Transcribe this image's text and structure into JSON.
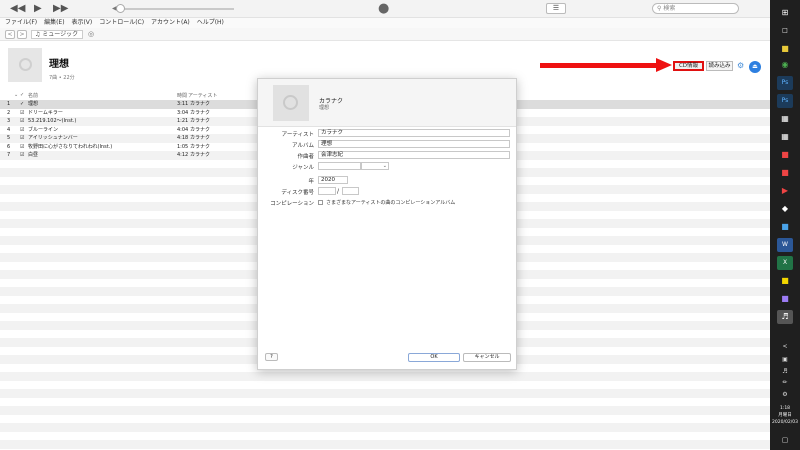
{
  "player": {
    "rewind": "◀◀",
    "play": "▶",
    "forward": "▶▶",
    "volume_icon": "◀"
  },
  "search": {
    "placeholder": "検索",
    "icon": "search-icon"
  },
  "menu": [
    "ファイル(F)",
    "編集(E)",
    "表示(V)",
    "コントロール(C)",
    "アカウント(A)",
    "ヘルプ(H)"
  ],
  "nav": {
    "back": "<",
    "forward": ">",
    "library": "♫ ミュージック"
  },
  "album": {
    "title": "理想",
    "meta": "7曲 • 22分",
    "cd_info_button": "CD情報",
    "import_button": "読み込み"
  },
  "table": {
    "headers": {
      "name": "名前",
      "time": "時間",
      "artist": "アーティスト"
    },
    "rows": [
      {
        "num": "1",
        "check": "✓",
        "name": "理想",
        "time": "3:11",
        "artist": "カラナク"
      },
      {
        "num": "2",
        "check": "☑",
        "name": "ドリームキラー",
        "time": "3:04",
        "artist": "カラナク"
      },
      {
        "num": "3",
        "check": "☑",
        "name": "53.219.102〜(Inst.)",
        "time": "1:21",
        "artist": "カラナク"
      },
      {
        "num": "4",
        "check": "☑",
        "name": "ブルーライン",
        "time": "4:04",
        "artist": "カラナク"
      },
      {
        "num": "5",
        "check": "☑",
        "name": "アイリッシュナンバー",
        "time": "4:18",
        "artist": "カラナク"
      },
      {
        "num": "6",
        "check": "☑",
        "name": "牧野田に心がさなりてわれわれ(Inst.)",
        "time": "1:05",
        "artist": "カラナク"
      },
      {
        "num": "7",
        "check": "☑",
        "name": "白昼",
        "time": "4:12",
        "artist": "カラナク"
      }
    ]
  },
  "dialog": {
    "header_artist": "カラナク",
    "header_album": "理想",
    "labels": {
      "artist": "アーティスト",
      "album": "アルバム",
      "composer": "作曲者",
      "genre": "ジャンル",
      "year": "年",
      "disc": "ディスク番号",
      "compilation": "コンピレーション"
    },
    "values": {
      "artist": "カラナク",
      "album": "理想",
      "composer": "会津志紀",
      "genre": "",
      "year": "2020",
      "disc_a": "",
      "disc_b": ""
    },
    "genre_caret": "⌄",
    "disc_slash": "/",
    "compilation_text": "さまざまなアーティストの曲のコンピレーションアルバム",
    "help_button": "?",
    "ok_button": "OK",
    "cancel_button": "キャンセル"
  },
  "taskbar": {
    "clock_time": "1:18",
    "clock_day": "月曜日",
    "clock_date": "2020/02/03",
    "chevron": "<"
  }
}
